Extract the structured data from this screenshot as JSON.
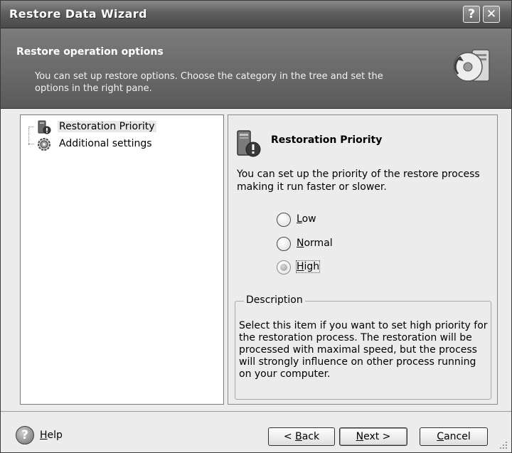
{
  "window": {
    "title": "Restore Data Wizard",
    "help_glyph": "?",
    "close_glyph": "✕"
  },
  "header": {
    "title": "Restore operation options",
    "description": "You can set up restore options. Choose the category in the tree and set the options in the right pane."
  },
  "tree": {
    "items": [
      {
        "label": "Restoration Priority",
        "icon": "priority-icon",
        "selected": true
      },
      {
        "label": "Additional settings",
        "icon": "settings-gear-icon",
        "selected": false
      }
    ]
  },
  "pane": {
    "title": "Restoration Priority",
    "text": "You can set up the priority of the restore process making it run faster or slower.",
    "options": [
      {
        "accel": "L",
        "rest": "ow",
        "checked": false
      },
      {
        "accel": "N",
        "rest": "ormal",
        "checked": false
      },
      {
        "accel": "H",
        "rest": "igh",
        "checked": true
      }
    ],
    "description_legend": "Description",
    "description_text": "Select this item if you want to set high priority for the restoration process. The restoration will be processed with maximal speed, but the process will strongly influence on other process running on your computer."
  },
  "footer": {
    "help_glyph": "?",
    "help": {
      "accel": "H",
      "rest": "elp"
    },
    "back": {
      "pre": "< ",
      "accel": "B",
      "rest": "ack"
    },
    "next": {
      "accel": "N",
      "rest": "ext >"
    },
    "cancel": {
      "accel": "C",
      "rest": "ancel"
    }
  },
  "colors": {
    "title_bar": "#5e5e5e",
    "header_band": "#6a6a6a",
    "window_bg": "#ececec",
    "tree_selection": "#e8e8e8"
  }
}
